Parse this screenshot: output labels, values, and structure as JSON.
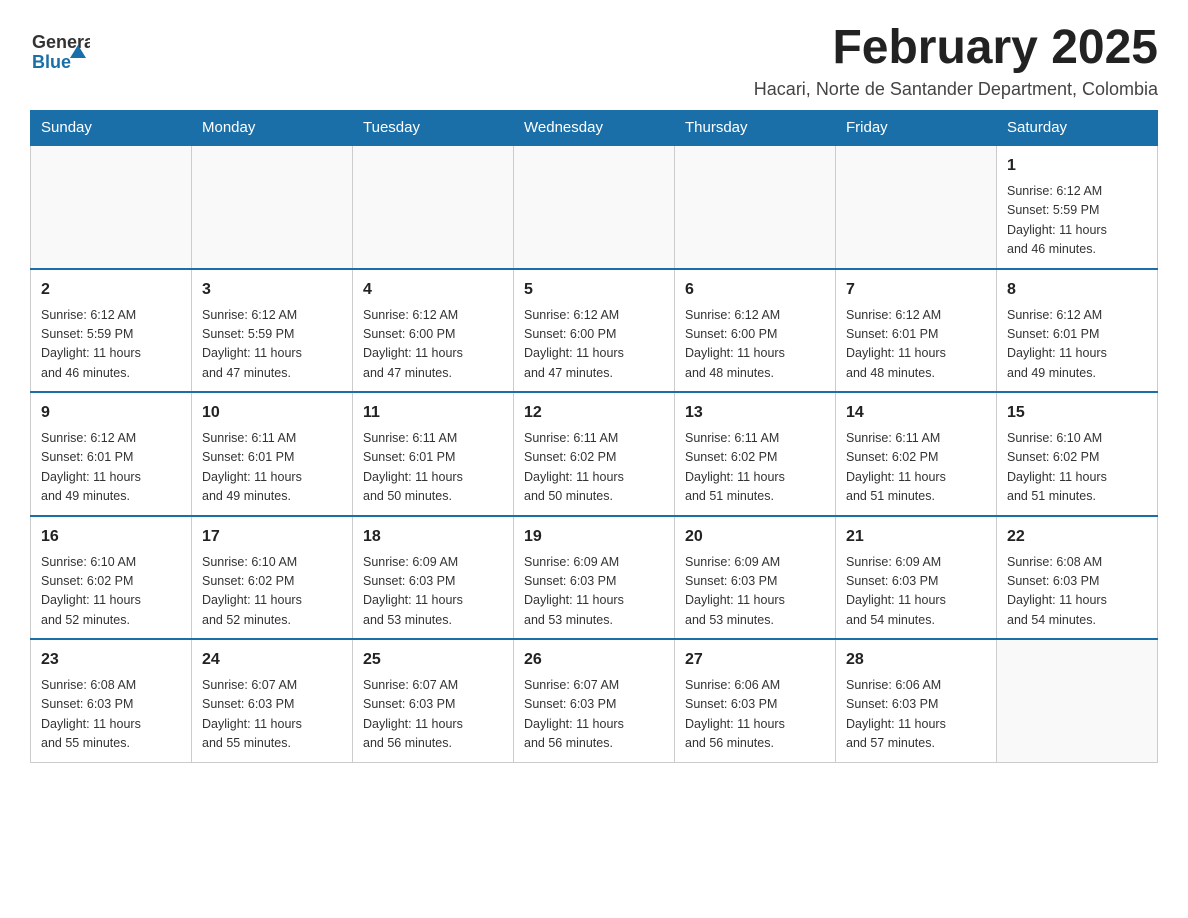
{
  "header": {
    "logo_general": "General",
    "logo_blue": "Blue",
    "month_title": "February 2025",
    "location": "Hacari, Norte de Santander Department, Colombia"
  },
  "days_of_week": [
    "Sunday",
    "Monday",
    "Tuesday",
    "Wednesday",
    "Thursday",
    "Friday",
    "Saturday"
  ],
  "weeks": [
    {
      "days": [
        {
          "number": "",
          "info": ""
        },
        {
          "number": "",
          "info": ""
        },
        {
          "number": "",
          "info": ""
        },
        {
          "number": "",
          "info": ""
        },
        {
          "number": "",
          "info": ""
        },
        {
          "number": "",
          "info": ""
        },
        {
          "number": "1",
          "info": "Sunrise: 6:12 AM\nSunset: 5:59 PM\nDaylight: 11 hours\nand 46 minutes."
        }
      ]
    },
    {
      "days": [
        {
          "number": "2",
          "info": "Sunrise: 6:12 AM\nSunset: 5:59 PM\nDaylight: 11 hours\nand 46 minutes."
        },
        {
          "number": "3",
          "info": "Sunrise: 6:12 AM\nSunset: 5:59 PM\nDaylight: 11 hours\nand 47 minutes."
        },
        {
          "number": "4",
          "info": "Sunrise: 6:12 AM\nSunset: 6:00 PM\nDaylight: 11 hours\nand 47 minutes."
        },
        {
          "number": "5",
          "info": "Sunrise: 6:12 AM\nSunset: 6:00 PM\nDaylight: 11 hours\nand 47 minutes."
        },
        {
          "number": "6",
          "info": "Sunrise: 6:12 AM\nSunset: 6:00 PM\nDaylight: 11 hours\nand 48 minutes."
        },
        {
          "number": "7",
          "info": "Sunrise: 6:12 AM\nSunset: 6:01 PM\nDaylight: 11 hours\nand 48 minutes."
        },
        {
          "number": "8",
          "info": "Sunrise: 6:12 AM\nSunset: 6:01 PM\nDaylight: 11 hours\nand 49 minutes."
        }
      ]
    },
    {
      "days": [
        {
          "number": "9",
          "info": "Sunrise: 6:12 AM\nSunset: 6:01 PM\nDaylight: 11 hours\nand 49 minutes."
        },
        {
          "number": "10",
          "info": "Sunrise: 6:11 AM\nSunset: 6:01 PM\nDaylight: 11 hours\nand 49 minutes."
        },
        {
          "number": "11",
          "info": "Sunrise: 6:11 AM\nSunset: 6:01 PM\nDaylight: 11 hours\nand 50 minutes."
        },
        {
          "number": "12",
          "info": "Sunrise: 6:11 AM\nSunset: 6:02 PM\nDaylight: 11 hours\nand 50 minutes."
        },
        {
          "number": "13",
          "info": "Sunrise: 6:11 AM\nSunset: 6:02 PM\nDaylight: 11 hours\nand 51 minutes."
        },
        {
          "number": "14",
          "info": "Sunrise: 6:11 AM\nSunset: 6:02 PM\nDaylight: 11 hours\nand 51 minutes."
        },
        {
          "number": "15",
          "info": "Sunrise: 6:10 AM\nSunset: 6:02 PM\nDaylight: 11 hours\nand 51 minutes."
        }
      ]
    },
    {
      "days": [
        {
          "number": "16",
          "info": "Sunrise: 6:10 AM\nSunset: 6:02 PM\nDaylight: 11 hours\nand 52 minutes."
        },
        {
          "number": "17",
          "info": "Sunrise: 6:10 AM\nSunset: 6:02 PM\nDaylight: 11 hours\nand 52 minutes."
        },
        {
          "number": "18",
          "info": "Sunrise: 6:09 AM\nSunset: 6:03 PM\nDaylight: 11 hours\nand 53 minutes."
        },
        {
          "number": "19",
          "info": "Sunrise: 6:09 AM\nSunset: 6:03 PM\nDaylight: 11 hours\nand 53 minutes."
        },
        {
          "number": "20",
          "info": "Sunrise: 6:09 AM\nSunset: 6:03 PM\nDaylight: 11 hours\nand 53 minutes."
        },
        {
          "number": "21",
          "info": "Sunrise: 6:09 AM\nSunset: 6:03 PM\nDaylight: 11 hours\nand 54 minutes."
        },
        {
          "number": "22",
          "info": "Sunrise: 6:08 AM\nSunset: 6:03 PM\nDaylight: 11 hours\nand 54 minutes."
        }
      ]
    },
    {
      "days": [
        {
          "number": "23",
          "info": "Sunrise: 6:08 AM\nSunset: 6:03 PM\nDaylight: 11 hours\nand 55 minutes."
        },
        {
          "number": "24",
          "info": "Sunrise: 6:07 AM\nSunset: 6:03 PM\nDaylight: 11 hours\nand 55 minutes."
        },
        {
          "number": "25",
          "info": "Sunrise: 6:07 AM\nSunset: 6:03 PM\nDaylight: 11 hours\nand 56 minutes."
        },
        {
          "number": "26",
          "info": "Sunrise: 6:07 AM\nSunset: 6:03 PM\nDaylight: 11 hours\nand 56 minutes."
        },
        {
          "number": "27",
          "info": "Sunrise: 6:06 AM\nSunset: 6:03 PM\nDaylight: 11 hours\nand 56 minutes."
        },
        {
          "number": "28",
          "info": "Sunrise: 6:06 AM\nSunset: 6:03 PM\nDaylight: 11 hours\nand 57 minutes."
        },
        {
          "number": "",
          "info": ""
        }
      ]
    }
  ]
}
